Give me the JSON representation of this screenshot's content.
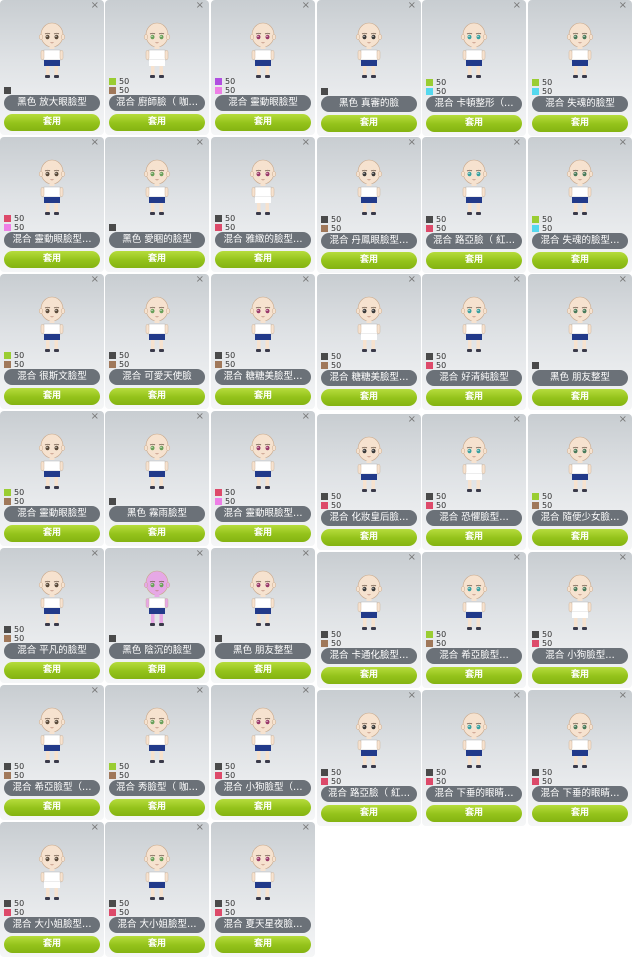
{
  "close_glyph": "×",
  "apply_label": "套用",
  "color_key": {
    "black": "#4a4a4a",
    "brown": "#a0785a",
    "green": "#9acd32",
    "purple": "#b04ee0",
    "pink": "#ee7fe6",
    "cyan": "#55d8ee",
    "red": "#dd4a6a"
  },
  "items": [
    {
      "label": "黑色 放大眼臉型",
      "swatches": [
        {
          "color": "black",
          "pct": ""
        }
      ]
    },
    {
      "label": "混合 廚師臉（ 咖…",
      "swatches": [
        {
          "color": "green",
          "pct": "50"
        },
        {
          "color": "brown",
          "pct": "50"
        }
      ]
    },
    {
      "label": "混合 靈動眼臉型",
      "swatches": [
        {
          "color": "purple",
          "pct": "50"
        },
        {
          "color": "pink",
          "pct": "50"
        }
      ]
    },
    {
      "label": "黑色 真審的臉",
      "swatches": [
        {
          "color": "black",
          "pct": ""
        }
      ]
    },
    {
      "label": "混合 卡頓整形（…",
      "swatches": [
        {
          "color": "green",
          "pct": "50"
        },
        {
          "color": "cyan",
          "pct": "50"
        }
      ]
    },
    {
      "label": "混合 失魂的臉型",
      "swatches": [
        {
          "color": "green",
          "pct": "50"
        },
        {
          "color": "cyan",
          "pct": "50"
        }
      ]
    },
    {
      "label": "混合 靈動眼臉型…",
      "swatches": [
        {
          "color": "red",
          "pct": "50"
        },
        {
          "color": "pink",
          "pct": "50"
        }
      ]
    },
    {
      "label": "黑色 愛睏的臉型",
      "swatches": [
        {
          "color": "black",
          "pct": ""
        }
      ]
    },
    {
      "label": "混合 雅緻的臉型…",
      "swatches": [
        {
          "color": "black",
          "pct": "50"
        },
        {
          "color": "red",
          "pct": "50"
        }
      ]
    },
    {
      "label": "混合 丹鳳眼臉型…",
      "swatches": [
        {
          "color": "black",
          "pct": "50"
        },
        {
          "color": "brown",
          "pct": "50"
        }
      ]
    },
    {
      "label": "混合 路亞臉（ 紅…",
      "swatches": [
        {
          "color": "black",
          "pct": "50"
        },
        {
          "color": "red",
          "pct": "50"
        }
      ]
    },
    {
      "label": "混合 失魂的臉型…",
      "swatches": [
        {
          "color": "green",
          "pct": "50"
        },
        {
          "color": "cyan",
          "pct": "50"
        }
      ]
    },
    {
      "label": "混合 很斯文臉型",
      "swatches": [
        {
          "color": "green",
          "pct": "50"
        },
        {
          "color": "brown",
          "pct": "50"
        }
      ]
    },
    {
      "label": "混合 可愛天使臉",
      "swatches": [
        {
          "color": "black",
          "pct": "50"
        },
        {
          "color": "brown",
          "pct": "50"
        }
      ]
    },
    {
      "label": "混合 糖糖美臉型…",
      "swatches": [
        {
          "color": "black",
          "pct": "50"
        },
        {
          "color": "brown",
          "pct": "50"
        }
      ]
    },
    {
      "label": "混合 糖糖美臉型…",
      "swatches": [
        {
          "color": "black",
          "pct": "50"
        },
        {
          "color": "brown",
          "pct": "50"
        }
      ]
    },
    {
      "label": "混合 好清純臉型",
      "swatches": [
        {
          "color": "black",
          "pct": "50"
        },
        {
          "color": "red",
          "pct": "50"
        }
      ]
    },
    {
      "label": "黑色 朋友整型",
      "swatches": [
        {
          "color": "black",
          "pct": ""
        }
      ]
    },
    {
      "label": "混合 靈動眼臉型",
      "swatches": [
        {
          "color": "green",
          "pct": "50"
        },
        {
          "color": "brown",
          "pct": "50"
        }
      ]
    },
    {
      "label": "黑色 霧雨臉型",
      "swatches": [
        {
          "color": "black",
          "pct": ""
        }
      ]
    },
    {
      "label": "混合 靈動眼臉型…",
      "swatches": [
        {
          "color": "red",
          "pct": "50"
        },
        {
          "color": "pink",
          "pct": "50"
        }
      ]
    },
    {
      "label": "混合 化妝皇后臉…",
      "swatches": [
        {
          "color": "black",
          "pct": "50"
        },
        {
          "color": "red",
          "pct": "50"
        }
      ]
    },
    {
      "label": "混合 恐懼臉型…",
      "swatches": [
        {
          "color": "black",
          "pct": "50"
        },
        {
          "color": "red",
          "pct": "50"
        }
      ]
    },
    {
      "label": "混合 隨便少女臉…",
      "swatches": [
        {
          "color": "green",
          "pct": "50"
        },
        {
          "color": "brown",
          "pct": "50"
        }
      ]
    },
    {
      "label": "混合 平凡的臉型",
      "swatches": [
        {
          "color": "black",
          "pct": "50"
        },
        {
          "color": "brown",
          "pct": "50"
        }
      ]
    },
    {
      "label": "黑色 陰沉的臉型",
      "swatches": [
        {
          "color": "black",
          "pct": ""
        }
      ]
    },
    {
      "label": "黑色 朋友整型",
      "swatches": [
        {
          "color": "black",
          "pct": ""
        }
      ]
    },
    {
      "label": "混合 卡通化臉型…",
      "swatches": [
        {
          "color": "black",
          "pct": "50"
        },
        {
          "color": "brown",
          "pct": "50"
        }
      ]
    },
    {
      "label": "混合 希亞臉型…",
      "swatches": [
        {
          "color": "green",
          "pct": "50"
        },
        {
          "color": "brown",
          "pct": "50"
        }
      ]
    },
    {
      "label": "混合 小狗臉型…",
      "swatches": [
        {
          "color": "black",
          "pct": "50"
        },
        {
          "color": "red",
          "pct": "50"
        }
      ]
    },
    {
      "label": "混合 希亞臉型（…",
      "swatches": [
        {
          "color": "black",
          "pct": "50"
        },
        {
          "color": "brown",
          "pct": "50"
        }
      ]
    },
    {
      "label": "混合 秀臉型（ 咖…",
      "swatches": [
        {
          "color": "green",
          "pct": "50"
        },
        {
          "color": "brown",
          "pct": "50"
        }
      ]
    },
    {
      "label": "混合 小狗臉型（…",
      "swatches": [
        {
          "color": "black",
          "pct": "50"
        },
        {
          "color": "red",
          "pct": "50"
        }
      ]
    },
    {
      "label": "混合 路亞臉（ 紅…",
      "swatches": [
        {
          "color": "black",
          "pct": "50"
        },
        {
          "color": "red",
          "pct": "50"
        }
      ]
    },
    {
      "label": "混合 下垂的眼睛…",
      "swatches": [
        {
          "color": "black",
          "pct": "50"
        },
        {
          "color": "red",
          "pct": "50"
        }
      ]
    },
    {
      "label": "混合 下垂的眼睛…",
      "swatches": [
        {
          "color": "black",
          "pct": "50"
        },
        {
          "color": "red",
          "pct": "50"
        }
      ]
    },
    {
      "label": "混合 大小姐臉型…",
      "swatches": [
        {
          "color": "black",
          "pct": "50"
        },
        {
          "color": "red",
          "pct": "50"
        }
      ]
    },
    {
      "label": "混合 大小姐臉型…",
      "swatches": [
        {
          "color": "black",
          "pct": "50"
        },
        {
          "color": "red",
          "pct": "50"
        }
      ]
    },
    {
      "label": "混合 夏天星夜臉…",
      "swatches": [
        {
          "color": "black",
          "pct": "50"
        },
        {
          "color": "red",
          "pct": "50"
        }
      ]
    }
  ]
}
